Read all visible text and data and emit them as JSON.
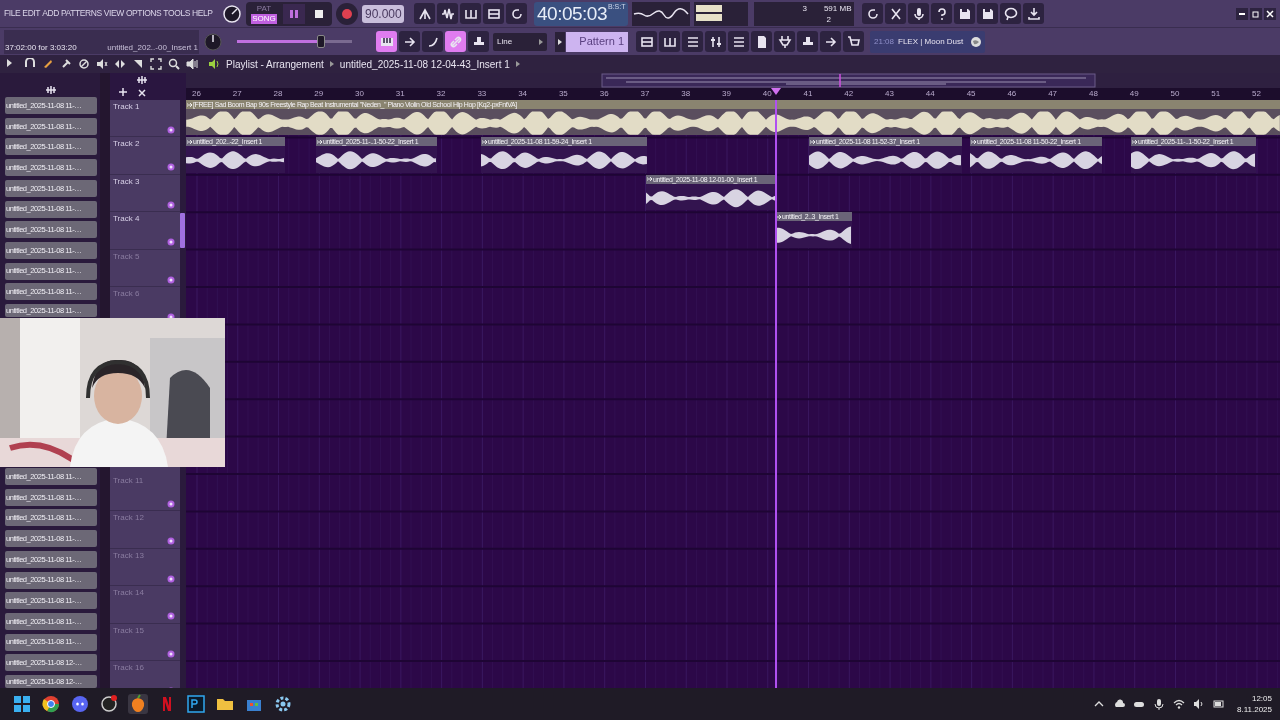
{
  "menu": [
    "FILE",
    "EDIT",
    "ADD",
    "PATTERNS",
    "VIEW",
    "OPTIONS",
    "TOOLS",
    "HELP"
  ],
  "transport": {
    "pat_label": "PAT",
    "song_label": "SONG",
    "song_mode": true,
    "tempo": "90.000",
    "time": "40:05:03",
    "time_format": "B:S:T"
  },
  "monitor": {
    "cpu": "3",
    "memory": "591 MB",
    "polyphony": "2"
  },
  "hint_bar": {
    "position": "37:02:00 for 3:03:20",
    "clip": "untitled_202..-00_Insert 1"
  },
  "main_volume": {
    "level": 0.75
  },
  "row2_toggles": [
    {
      "on": true
    },
    {
      "on": false
    },
    {
      "on": false
    },
    {
      "on": true
    },
    {
      "on": false
    }
  ],
  "snap": "Line",
  "pattern": "Pattern 1",
  "news": {
    "time": "21:08",
    "text": "FLEX | Moon Dust"
  },
  "playlist": {
    "title": "Playlist - Arrangement",
    "clip": "untitled_2025-11-08 12-04-43_Insert 1",
    "bars": [
      "26",
      "27",
      "28",
      "29",
      "30",
      "31",
      "32",
      "33",
      "34",
      "35",
      "36",
      "37",
      "38",
      "39",
      "40",
      "41",
      "42",
      "43",
      "44",
      "45",
      "46",
      "47",
      "48",
      "49",
      "50",
      "51",
      "52"
    ],
    "clip_list_upper": [
      "untitled_2025-11-08 11-…",
      "untitled_2025-11-08 11-…",
      "untitled_2025-11-08 11-…",
      "untitled_2025-11-08 11-…",
      "untitled_2025-11-08 11-…",
      "untitled_2025-11-08 11-…",
      "untitled_2025-11-08 11-…",
      "untitled_2025-11-08 11-…",
      "untitled_2025-11-08 11-…",
      "untitled_2025-11-08 11-…",
      "untitled_2025-11-08 11-…"
    ],
    "clip_list_lower": [
      "untitled_2025-11-08 11-…",
      "untitled_2025-11-08 11-…",
      "untitled_2025-11-08 11-…",
      "untitled_2025-11-08 11-…",
      "untitled_2025-11-08 11-…",
      "untitled_2025-11-08 11-…",
      "untitled_2025-11-08 11-…",
      "untitled_2025-11-08 11-…",
      "untitled_2025-11-08 11-…",
      "untitled_2025-11-08 12-…",
      "untitled_2025-11-08 12-…"
    ],
    "tracks_upper": [
      {
        "label": "Track 1",
        "dimmed": false
      },
      {
        "label": "Track 2",
        "dimmed": false
      },
      {
        "label": "Track 3",
        "dimmed": false
      },
      {
        "label": "Track 4",
        "dimmed": false
      },
      {
        "label": "Track 5",
        "dimmed": true
      },
      {
        "label": "Track 6",
        "dimmed": true
      }
    ],
    "tracks_lower": [
      {
        "label": "Track 11",
        "dimmed": true
      },
      {
        "label": "Track 12",
        "dimmed": true
      },
      {
        "label": "Track 13",
        "dimmed": true
      },
      {
        "label": "Track 14",
        "dimmed": true
      },
      {
        "label": "Track 15",
        "dimmed": true
      },
      {
        "label": "Track 16",
        "dimmed": true
      }
    ],
    "clips": [
      {
        "title": "[FREE] Sad Boom Bap 90s Freestyle Rap Beat Instrumental \"Neden_\" Piano Violin Old School Hip Hop [Kq2-pxFntVA]"
      },
      {
        "title": "untitled_202..-22_Insert 1"
      },
      {
        "title": "untitled_2025-11-..1-50-22_Insert 1"
      },
      {
        "title": "untitled_2025-11-08 11-59-24_Insert 1"
      },
      {
        "title": "untitled_2025-11-08 11-52-37_Insert 1"
      },
      {
        "title": "untitled_2025-11-08 11-50-22_Insert 1"
      },
      {
        "title": "untitled_2025-11-..1-50-22_Insert 1"
      },
      {
        "title": "untitled_2025-11-08 12-01-00_Insert 1"
      },
      {
        "title": "untitled_2..3_Insert 1"
      }
    ]
  },
  "taskbar": {
    "time": "12:05",
    "date": "8.11.2025"
  }
}
